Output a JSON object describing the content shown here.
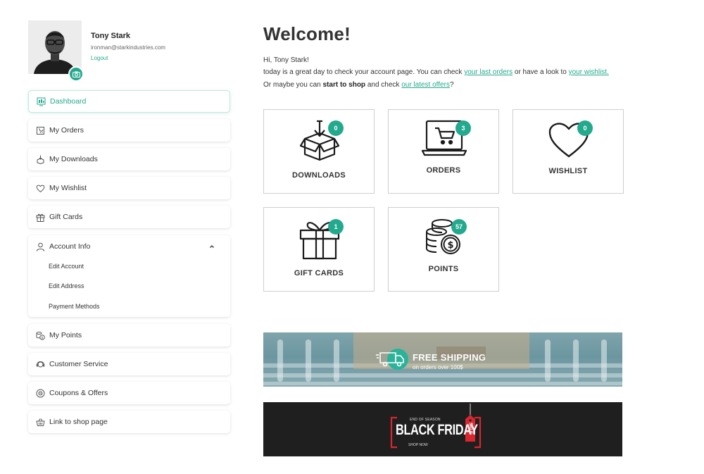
{
  "profile": {
    "name": "Tony Stark",
    "email": "ironman@starkindustries.com",
    "logout": "Logout"
  },
  "sidebar": {
    "items": [
      {
        "label": "Dashboard"
      },
      {
        "label": "My Orders"
      },
      {
        "label": "My Downloads"
      },
      {
        "label": "My Wishlist"
      },
      {
        "label": "Gift Cards"
      },
      {
        "label": "Account Info"
      },
      {
        "label": "My Points"
      },
      {
        "label": "Customer Service"
      },
      {
        "label": "Coupons & Offers"
      },
      {
        "label": "Link to shop page"
      }
    ],
    "account_sub": [
      {
        "label": "Edit Account"
      },
      {
        "label": "Edit Address"
      },
      {
        "label": "Payment Methods"
      }
    ]
  },
  "main": {
    "title": "Welcome!",
    "greeting": "Hi, Tony Stark!",
    "line2_pre": "today is a great day to check your account page. You can check ",
    "line2_link1": "your last orders",
    "line2_mid": " or have a look to ",
    "line2_link2": "your wishlist.",
    "line3_pre": "Or maybe you can ",
    "line3_bold": "start to shop",
    "line3_mid": " and check ",
    "line3_link": "our latest offers",
    "line3_end": "?"
  },
  "tiles": [
    {
      "label": "DOWNLOADS",
      "count": "0",
      "icon": "box-download-icon"
    },
    {
      "label": "ORDERS",
      "count": "3",
      "icon": "laptop-cart-icon"
    },
    {
      "label": "WISHLIST",
      "count": "0",
      "icon": "heart-icon"
    },
    {
      "label": "GIFT CARDS",
      "count": "1",
      "icon": "gift-icon"
    },
    {
      "label": "POINTS",
      "count": "57",
      "icon": "coins-icon"
    }
  ],
  "banners": {
    "shipping_title": "FREE SHIPPING",
    "shipping_sub": "on orders over 100$",
    "friday_top": "END OF SEASON",
    "friday_title": "BLACK FRIDAY",
    "friday_sale": "SALE",
    "friday_bottom": "SHOP NOW"
  },
  "colors": {
    "accent": "#23a98d",
    "text": "#333333",
    "tile_border": "#cfcfcf",
    "sale_red": "#d9262f"
  }
}
